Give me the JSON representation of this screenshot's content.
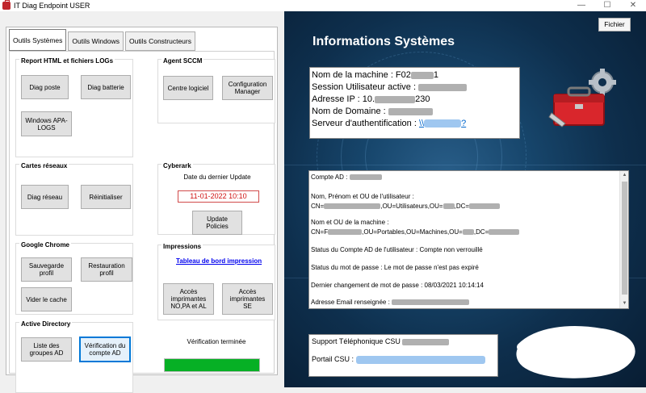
{
  "window": {
    "title": "IT Diag Endpoint USER",
    "minimize": "—",
    "maximize": "☐",
    "close": "✕"
  },
  "tabs": [
    {
      "label": "Outils Systèmes"
    },
    {
      "label": "Outils Windows"
    },
    {
      "label": "Outils Constructeurs"
    }
  ],
  "groups": {
    "report": {
      "title": "Report HTML et fichiers LOGs",
      "btn_diag_poste": "Diag poste",
      "btn_diag_batterie": "Diag batterie",
      "btn_windows_apa_1": "Windows APA-",
      "btn_windows_apa_2": "LOGS"
    },
    "sccm": {
      "title": "Agent SCCM",
      "btn_centre": "Centre logiciel",
      "btn_config_1": "Configuration",
      "btn_config_2": "Manager"
    },
    "cartes": {
      "title": "Cartes réseaux",
      "btn_diag_reseau": "Diag réseau",
      "btn_reinit": "Réinitialiser"
    },
    "cyberark": {
      "title": "Cyberark",
      "date_label": "Date du dernier Update",
      "date_value": "11-01-2022 10:10",
      "btn_update_1": "Update",
      "btn_update_2": "Policies"
    },
    "chrome": {
      "title": "Google Chrome",
      "btn_sauvegarde_1": "Sauvegarde",
      "btn_sauvegarde_2": "profil",
      "btn_restauration_1": "Restauration",
      "btn_restauration_2": "profil",
      "btn_vider": "Vider le cache"
    },
    "impressions": {
      "title": "Impressions",
      "link": "Tableau de bord impression",
      "btn_acces1_1": "Accès",
      "btn_acces1_2": "imprimantes",
      "btn_acces1_3": "NO,PA et AL",
      "btn_acces2_1": "Accès",
      "btn_acces2_2": "imprimantes",
      "btn_acces2_3": "SE"
    },
    "ad": {
      "title": "Active Directory",
      "btn_liste_1": "Liste des",
      "btn_liste_2": "groupes AD",
      "btn_verif_1": "Vérification du",
      "btn_verif_2": "compte AD"
    }
  },
  "status": {
    "verification": "Vérification terminée",
    "progress": 1.0
  },
  "right": {
    "fichier": "Fichier",
    "heading": "Informations Systèmes",
    "info": {
      "machine": "Nom de la machine : F02",
      "machine_tail": "1",
      "session": "Session Utilisateur active : ",
      "ip": "Adresse IP : 10.",
      "ip_tail": "230",
      "domain": "Nom de Domaine : ",
      "auth": "Serveur d'authentification : ",
      "auth_link": "\\\\",
      "auth_link_tail": "?"
    },
    "details": {
      "compte": "Compte AD : ",
      "nom_label": "Nom, Prénom et OU de l'utilisateur :",
      "cn_user": "CN=",
      "cn_user_mid": ",OU=Utilisateurs,OU=",
      "cn_user_tail": ",DC=",
      "nom_machine_label": "Nom et OU de la machine :",
      "cn_machine": "CN=F",
      "cn_machine_mid": ",OU=Portables,OU=Machines,OU=",
      "cn_machine_tail": ",DC=",
      "statut_compte": "Status du Compte AD de l'utilisateur : Compte non verrouillé",
      "statut_mdp": "Status du mot de passe : Le mot de passe n'est pas expiré",
      "dernier_changement": "Dernier changement de mot de passe : 08/03/2021 10:14:14",
      "email": "Adresse Email renseignée : "
    },
    "support": {
      "telephone": "Support Téléphonique CSU ",
      "portail": "Portail CSU : "
    }
  },
  "colors": {
    "accent": "#0078d7",
    "progress": "#06b025",
    "date_red": "#d01010",
    "link": "#0000ee"
  }
}
